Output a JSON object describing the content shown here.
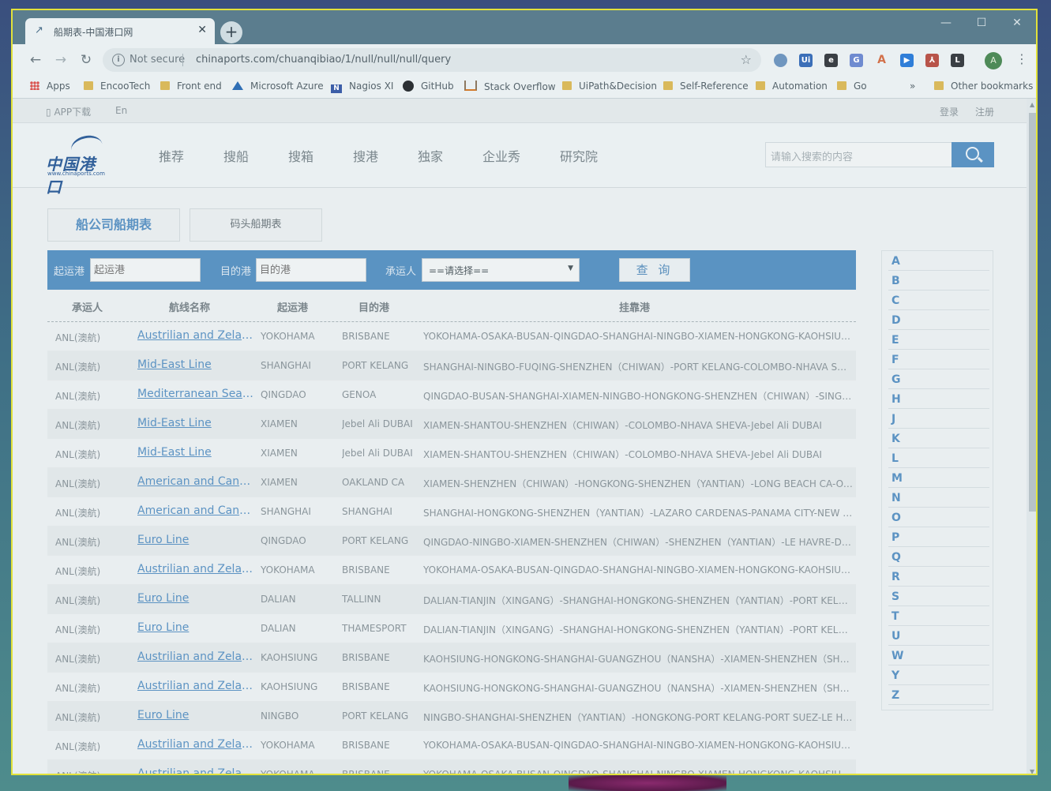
{
  "browser": {
    "tab_title": "船期表-中国港口网",
    "new_tab_symbol": "+",
    "security_label": "Not secure",
    "url": "chinaports.com/chuanqibiao/1/null/null/null/query",
    "profile_initial": "A",
    "bookmarks": [
      {
        "label": "Apps",
        "icon": "apps-grid-icon"
      },
      {
        "label": "EncooTech",
        "icon": "folder-icon"
      },
      {
        "label": "Front end",
        "icon": "folder-icon"
      },
      {
        "label": "Microsoft Azure",
        "icon": "azure-icon"
      },
      {
        "label": "Nagios XI",
        "icon": "nagios-icon"
      },
      {
        "label": "GitHub",
        "icon": "github-icon"
      },
      {
        "label": "Stack Overflow",
        "icon": "stackoverflow-icon"
      },
      {
        "label": "UiPath&Decision",
        "icon": "folder-icon"
      },
      {
        "label": "Self-Reference",
        "icon": "folder-icon"
      },
      {
        "label": "Automation",
        "icon": "folder-icon"
      },
      {
        "label": "Go",
        "icon": "folder-icon"
      }
    ],
    "bookmarks_overflow": "»",
    "other_bookmarks": "Other bookmarks"
  },
  "site": {
    "util_left": [
      "APP下载",
      "En"
    ],
    "util_right": [
      "登录",
      "注册"
    ],
    "logo_text": "中国港口",
    "logo_url": "www.chinaports.com",
    "nav": [
      "推荐",
      "搜船",
      "搜箱",
      "搜港",
      "独家",
      "企业秀",
      "研究院"
    ],
    "search_placeholder": "请输入搜索的内容",
    "tabs": [
      "船公司船期表",
      "码头船期表"
    ],
    "filter": {
      "origin_label": "起运港",
      "origin_placeholder": "起运港",
      "dest_label": "目的港",
      "dest_placeholder": "目的港",
      "carrier_label": "承运人",
      "carrier_selected": "==请选择==",
      "query_label": "查 询"
    },
    "table": {
      "headers": [
        "承运人",
        "航线名称",
        "起运港",
        "目的港",
        "挂靠港"
      ],
      "rows": [
        [
          "ANL(澳航)",
          "Austrilian and Zeland Line",
          "YOKOHAMA",
          "BRISBANE",
          "YOKOHAMA-OSAKA-BUSAN-QINGDAO-SHANGHAI-NINGBO-XIAMEN-HONGKONG-KAOHSIUNG"
        ],
        [
          "ANL(澳航)",
          "Mid-East Line",
          "SHANGHAI",
          "PORT KELANG",
          "SHANGHAI-NINGBO-FUQING-SHENZHEN（CHIWAN）-PORT KELANG-COLOMBO-NHAVA SHEVA"
        ],
        [
          "ANL(澳航)",
          "Mediterranean Sea Line",
          "QINGDAO",
          "GENOA",
          "QINGDAO-BUSAN-SHANGHAI-XIAMEN-NINGBO-HONGKONG-SHENZHEN（CHIWAN）-SINGAPORE"
        ],
        [
          "ANL(澳航)",
          "Mid-East Line",
          "XIAMEN",
          "Jebel Ali DUBAI",
          "XIAMEN-SHANTOU-SHENZHEN（CHIWAN）-COLOMBO-NHAVA SHEVA-Jebel Ali DUBAI"
        ],
        [
          "ANL(澳航)",
          "Mid-East Line",
          "XIAMEN",
          "Jebel Ali DUBAI",
          "XIAMEN-SHANTOU-SHENZHEN（CHIWAN）-COLOMBO-NHAVA SHEVA-Jebel Ali DUBAI"
        ],
        [
          "ANL(澳航)",
          "American and Canada Line",
          "XIAMEN",
          "OAKLAND CA",
          "XIAMEN-SHENZHEN（CHIWAN）-HONGKONG-SHENZHEN（YANTIAN）-LONG BEACH CA-OAKLAND CA"
        ],
        [
          "ANL(澳航)",
          "American and Canada Line",
          "SHANGHAI",
          "SHANGHAI",
          "SHANGHAI-HONGKONG-SHENZHEN（YANTIAN）-LAZARO CARDENAS-PANAMA CITY-NEW YORK"
        ],
        [
          "ANL(澳航)",
          "Euro Line",
          "QINGDAO",
          "PORT KELANG",
          "QINGDAO-NINGBO-XIAMEN-SHENZHEN（CHIWAN）-SHENZHEN（YANTIAN）-LE HAVRE-DUNKIRK"
        ],
        [
          "ANL(澳航)",
          "Austrilian and Zeland Line",
          "YOKOHAMA",
          "BRISBANE",
          "YOKOHAMA-OSAKA-BUSAN-QINGDAO-SHANGHAI-NINGBO-XIAMEN-HONGKONG-KAOHSIUNG"
        ],
        [
          "ANL(澳航)",
          "Euro Line",
          "DALIAN",
          "TALLINN",
          "DALIAN-TIANJIN（XINGANG）-SHANGHAI-HONGKONG-SHENZHEN（YANTIAN）-PORT KELANG"
        ],
        [
          "ANL(澳航)",
          "Euro Line",
          "DALIAN",
          "THAMESPORT",
          "DALIAN-TIANJIN（XINGANG）-SHANGHAI-HONGKONG-SHENZHEN（YANTIAN）-PORT KELANG"
        ],
        [
          "ANL(澳航)",
          "Austrilian and Zeland Line",
          "KAOHSIUNG",
          "BRISBANE",
          "KAOHSIUNG-HONGKONG-SHANGHAI-GUANGZHOU（NANSHA）-XIAMEN-SHENZHEN（SHEKOU）"
        ],
        [
          "ANL(澳航)",
          "Austrilian and Zeland Line",
          "KAOHSIUNG",
          "BRISBANE",
          "KAOHSIUNG-HONGKONG-SHANGHAI-GUANGZHOU（NANSHA）-XIAMEN-SHENZHEN（SHEKOU）"
        ],
        [
          "ANL(澳航)",
          "Euro Line",
          "NINGBO",
          "PORT KELANG",
          "NINGBO-SHANGHAI-SHENZHEN（YANTIAN）-HONGKONG-PORT KELANG-PORT SUEZ-LE HAVRE"
        ],
        [
          "ANL(澳航)",
          "Austrilian and Zeland Line",
          "YOKOHAMA",
          "BRISBANE",
          "YOKOHAMA-OSAKA-BUSAN-QINGDAO-SHANGHAI-NINGBO-XIAMEN-HONGKONG-KAOHSIUNG"
        ],
        [
          "ANL(澳航)",
          "Austrilian and Zeland Line",
          "YOKOHAMA",
          "BRISBANE",
          "YOKOHAMA-OSAKA-BUSAN-QINGDAO-SHANGHAI-NINGBO-XIAMEN-HONGKONG-KAOHSIUNG"
        ]
      ]
    },
    "alphabet": [
      "A",
      "B",
      "C",
      "D",
      "E",
      "F",
      "G",
      "H",
      "J",
      "K",
      "L",
      "M",
      "N",
      "O",
      "P",
      "Q",
      "R",
      "S",
      "T",
      "U",
      "W",
      "Y",
      "Z"
    ]
  }
}
